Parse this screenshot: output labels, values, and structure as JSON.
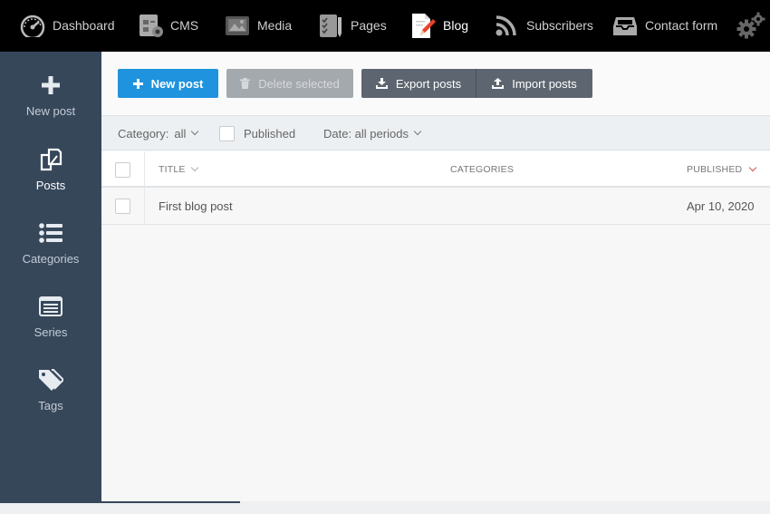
{
  "topnav": {
    "items": [
      {
        "label": "Dashboard",
        "icon": "dashboard-icon"
      },
      {
        "label": "CMS",
        "icon": "cms-icon"
      },
      {
        "label": "Media",
        "icon": "media-icon"
      },
      {
        "label": "Pages",
        "icon": "pages-icon"
      },
      {
        "label": "Blog",
        "icon": "blog-icon",
        "active": true
      },
      {
        "label": "Subscribers",
        "icon": "rss-icon"
      },
      {
        "label": "Contact form",
        "icon": "inbox-icon"
      }
    ],
    "settings_icon": "gears-icon"
  },
  "sidebar": {
    "items": [
      {
        "label": "New post",
        "icon": "plus-icon"
      },
      {
        "label": "Posts",
        "icon": "posts-icon",
        "active": true
      },
      {
        "label": "Categories",
        "icon": "list-icon"
      },
      {
        "label": "Series",
        "icon": "series-icon"
      },
      {
        "label": "Tags",
        "icon": "tags-icon"
      }
    ]
  },
  "toolbar": {
    "new_post": "New post",
    "delete_selected": "Delete selected",
    "export_posts": "Export posts",
    "import_posts": "Import posts"
  },
  "filters": {
    "category_label": "Category:",
    "category_value": "all",
    "published_label": "Published",
    "date_label": "Date: all periods"
  },
  "table": {
    "columns": {
      "title": "TITLE",
      "categories": "CATEGORIES",
      "published": "PUBLISHED"
    },
    "rows": [
      {
        "title": "First blog post",
        "categories": "",
        "published": "Apr 10, 2020"
      }
    ]
  },
  "colors": {
    "topbar": "#000000",
    "sidebar": "#36475a",
    "primary_button": "#1f93de",
    "secondary_button": "#5d6670",
    "sort_indicator": "#d9534f"
  }
}
